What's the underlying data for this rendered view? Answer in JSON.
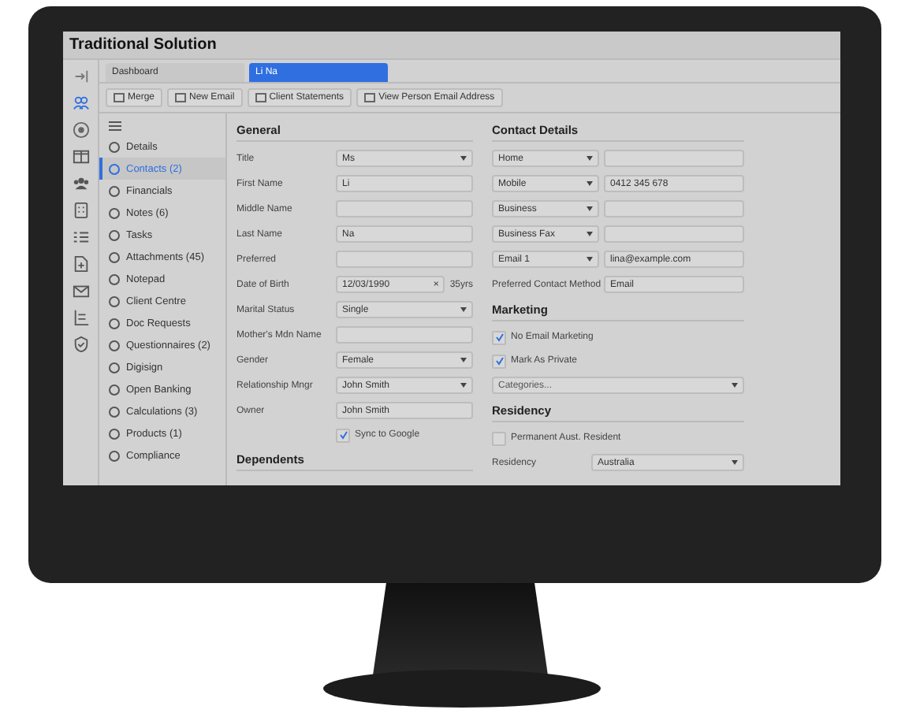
{
  "window": {
    "title": "Traditional Solution"
  },
  "tabs": [
    {
      "label": "Dashboard",
      "selected": false
    },
    {
      "label": "Li Na",
      "selected": true
    }
  ],
  "toolbar": [
    {
      "label": "Merge"
    },
    {
      "label": "New Email"
    },
    {
      "label": "Client Statements"
    },
    {
      "label": "View Person Email Address"
    }
  ],
  "nav": [
    {
      "label": "Details",
      "selected": false
    },
    {
      "label": "Contacts (2)",
      "selected": true
    },
    {
      "label": "Financials",
      "selected": false
    },
    {
      "label": "Notes (6)",
      "selected": false
    },
    {
      "label": "Tasks",
      "selected": false
    },
    {
      "label": "Attachments (45)",
      "selected": false
    },
    {
      "label": "Notepad",
      "selected": false
    },
    {
      "label": "Client Centre",
      "selected": false
    },
    {
      "label": "Doc Requests",
      "selected": false
    },
    {
      "label": "Questionnaires (2)",
      "selected": false
    },
    {
      "label": "Digisign",
      "selected": false
    },
    {
      "label": "Open Banking",
      "selected": false
    },
    {
      "label": "Calculations (3)",
      "selected": false
    },
    {
      "label": "Products (1)",
      "selected": false
    },
    {
      "label": "Compliance",
      "selected": false
    }
  ],
  "general": {
    "title": "General",
    "fields": [
      {
        "label": "Title",
        "kind": "select",
        "value": "Ms"
      },
      {
        "label": "First Name",
        "kind": "text",
        "value": "Li"
      },
      {
        "label": "Middle Name",
        "kind": "text"
      },
      {
        "label": "Last Name",
        "kind": "text",
        "value": "Na"
      },
      {
        "label": "Preferred",
        "kind": "text"
      },
      {
        "label": "Date of Birth",
        "kind": "date",
        "value": "12/03/1990",
        "clear": "×",
        "age": "35yrs"
      },
      {
        "label": "Marital Status",
        "kind": "select",
        "value": "Single"
      },
      {
        "label": "Mother's Mdn Name",
        "kind": "text"
      },
      {
        "label": "Gender",
        "kind": "select",
        "value": "Female"
      },
      {
        "label": "Relationship Mngr",
        "kind": "select",
        "value": "John Smith"
      },
      {
        "label": "Owner",
        "kind": "text",
        "value": "John Smith"
      }
    ],
    "sync": {
      "label": "Sync to Google",
      "checked": true
    }
  },
  "dependents": {
    "title": "Dependents"
  },
  "contact": {
    "title": "Contact Details",
    "rows": [
      {
        "type": "Home",
        "kind": "select"
      },
      {
        "type": "Mobile",
        "kind": "select",
        "value": "0412 345 678"
      },
      {
        "type": "Business",
        "kind": "select"
      },
      {
        "type": "Business Fax",
        "kind": "select"
      },
      {
        "type": "Email 1",
        "kind": "select",
        "value": "lina@example.com"
      },
      {
        "type": "Preferred Contact Method",
        "kind": "label",
        "value": "Email"
      }
    ]
  },
  "marketing": {
    "title": "Marketing",
    "options": [
      {
        "label": "No Email Marketing",
        "checked": true
      },
      {
        "label": "Mark As Private",
        "checked": true
      }
    ],
    "categories": {
      "placeholder": "Categories..."
    }
  },
  "residency": {
    "title": "Residency",
    "permanent": {
      "label": "Permanent Aust. Resident",
      "checked": false
    },
    "field": {
      "label": "Residency",
      "value": "Australia"
    }
  }
}
